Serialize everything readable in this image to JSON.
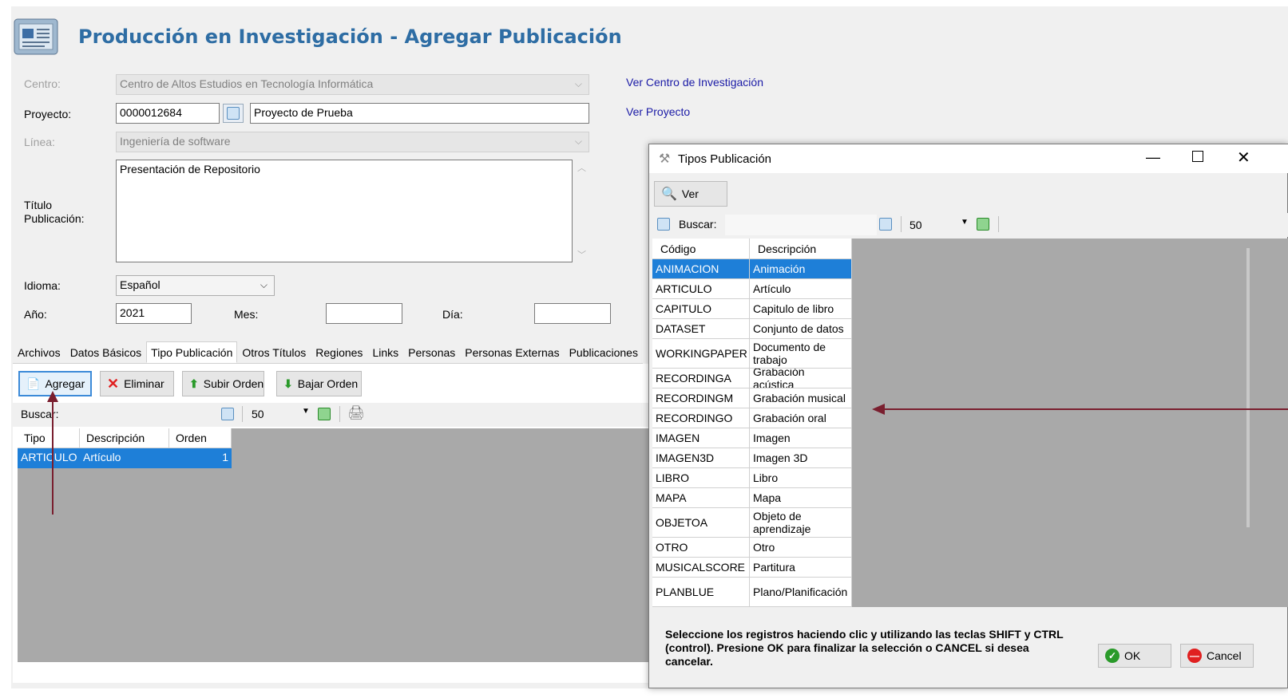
{
  "app": {
    "title": "Producción en Investigación - Agregar Publicación"
  },
  "form": {
    "centro": {
      "label": "Centro:",
      "value": "Centro de Altos Estudios en Tecnología Informática",
      "link": "Ver Centro de Investigación"
    },
    "proyecto": {
      "label": "Proyecto:",
      "code": "0000012684",
      "name": "Proyecto de Prueba",
      "link": "Ver Proyecto"
    },
    "linea": {
      "label": "Línea:",
      "value": "Ingeniería de software"
    },
    "titulo": {
      "label": "Título\nPublicación:",
      "value": "Presentación de Repositorio"
    },
    "idioma": {
      "label": "Idioma:",
      "value": "Español"
    },
    "anio": {
      "label": "Año:",
      "value": "2021"
    },
    "mes": {
      "label": "Mes:",
      "value": ""
    },
    "dia": {
      "label": "Día:",
      "value": ""
    }
  },
  "tabs": [
    "Archivos",
    "Datos Básicos",
    "Tipo Publicación",
    "Otros Títulos",
    "Regiones",
    "Links",
    "Personas",
    "Personas Externas",
    "Publicaciones"
  ],
  "active_tab": "Tipo Publicación",
  "toolbar": {
    "agregar": "Agregar",
    "eliminar": "Eliminar",
    "subir": "Subir Orden",
    "bajar": "Bajar Orden",
    "buscar_label": "Buscar:",
    "page_size": "50"
  },
  "grid": {
    "columns": [
      "Tipo",
      "Descripción",
      "Orden"
    ],
    "rows": [
      {
        "tipo": "ARTICULO",
        "descripcion": "Artículo",
        "orden": "1"
      }
    ]
  },
  "dialog": {
    "title": "Tipos Publicación",
    "ver_label": "Ver",
    "buscar_label": "Buscar:",
    "page_size": "50",
    "columns": [
      "Código",
      "Descripción"
    ],
    "rows": [
      {
        "codigo": "ANIMACION",
        "descripcion": "Animación",
        "selected": true
      },
      {
        "codigo": "ARTICULO",
        "descripcion": "Artículo"
      },
      {
        "codigo": "CAPITULO",
        "descripcion": "Capitulo de libro"
      },
      {
        "codigo": "DATASET",
        "descripcion": "Conjunto de datos"
      },
      {
        "codigo": "WORKINGPAPER",
        "descripcion": "Documento de trabajo"
      },
      {
        "codigo": "RECORDINGA",
        "descripcion": "Grabación acústica"
      },
      {
        "codigo": "RECORDINGM",
        "descripcion": "Grabación musical"
      },
      {
        "codigo": "RECORDINGO",
        "descripcion": "Grabación oral"
      },
      {
        "codigo": "IMAGEN",
        "descripcion": "Imagen"
      },
      {
        "codigo": "IMAGEN3D",
        "descripcion": "Imagen 3D"
      },
      {
        "codigo": "LIBRO",
        "descripcion": "Libro"
      },
      {
        "codigo": "MAPA",
        "descripcion": "Mapa"
      },
      {
        "codigo": "OBJETOA",
        "descripcion": "Objeto de aprendizaje"
      },
      {
        "codigo": "OTRO",
        "descripcion": "Otro"
      },
      {
        "codigo": "MUSICALSCORE",
        "descripcion": "Partitura"
      },
      {
        "codigo": "PLANBLUE",
        "descripcion": "Plano/Planificación"
      }
    ],
    "message": "Seleccione los registros haciendo clic y utilizando las teclas SHIFT y CTRL (control). Presione OK para finalizar la selección o CANCEL si desea cancelar.",
    "ok_label": "OK",
    "cancel_label": "Cancel"
  },
  "colors": {
    "title": "#2e6da4",
    "selection": "#1e7fd8",
    "grid_bg": "#a9a9a9",
    "annotation_arrow": "#7a1f2f",
    "link": "#1a1aa6"
  }
}
